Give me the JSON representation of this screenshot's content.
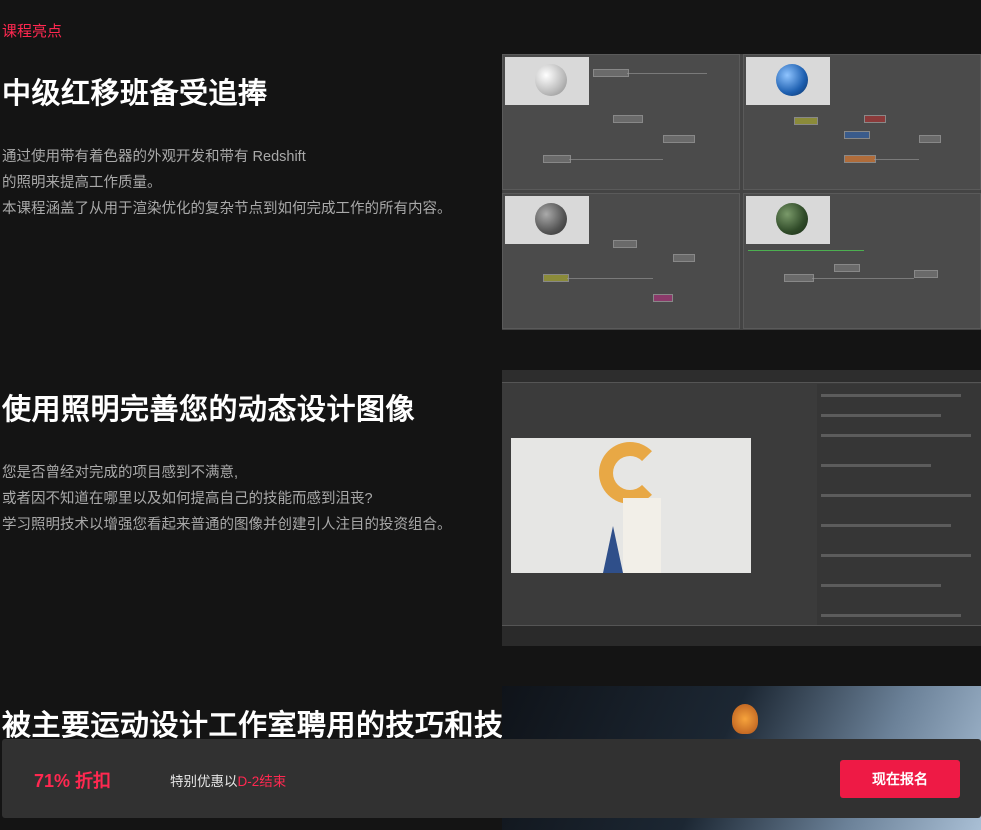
{
  "section_tag": "课程亮点",
  "sections": [
    {
      "title": "中级红移班备受追捧",
      "lines": [
        "通过使用带有着色器的外观开发和带有 Redshift",
        "的照明来提高工作质量。",
        "本课程涵盖了从用于渲染优化的复杂节点到如何完成工作的所有内容。"
      ]
    },
    {
      "title": "使用照明完善您的动态设计图像",
      "lines": [
        "您是否曾经对完成的项目感到不满意,",
        "或者因不知道在哪里以及如何提高自己的技能而感到沮丧?",
        "学习照明技术以增强您看起来普通的图像并创建引人注目的投资组合。"
      ]
    },
    {
      "title": "被主要运动设计工作室聘用的技巧和技",
      "lines": []
    }
  ],
  "promo": {
    "discount": "71% 折扣",
    "offer_text": "特别优惠以",
    "offer_end": "D-2结束",
    "cta_label": "现在报名"
  },
  "colors": {
    "accent": "#ff2850",
    "cta": "#ee1a45",
    "background": "#141414",
    "promo_bar": "#313131"
  }
}
